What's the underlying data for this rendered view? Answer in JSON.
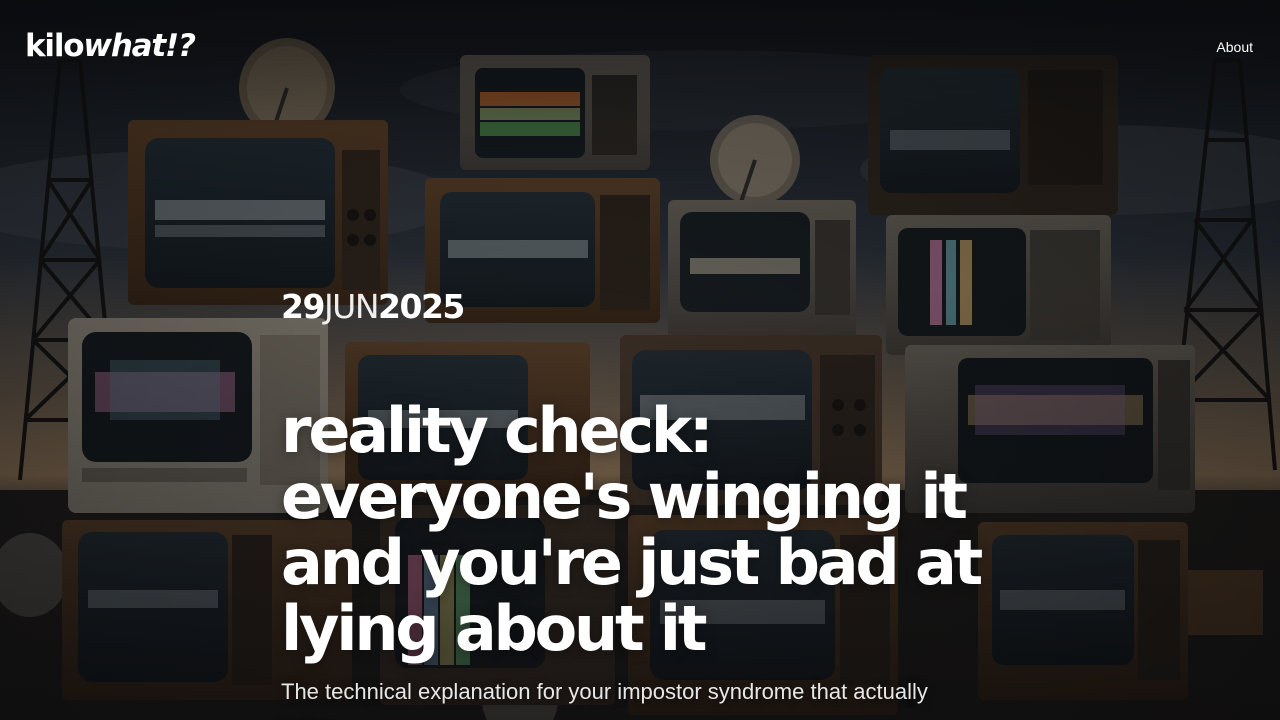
{
  "site": {
    "logo_plain": "kilo",
    "logo_italic": "what!?"
  },
  "nav": {
    "about_label": "About"
  },
  "post": {
    "date": {
      "day": "29",
      "month": "JUN",
      "year": "2025"
    },
    "title": "reality check: everyone's winging it and you're just bad at lying about it",
    "subtitle": "The technical explanation for your impostor syndrome that actually helps"
  },
  "hero_image": {
    "subject": "stacked vintage CRT televisions with radio towers at dusk",
    "colors": {
      "sky_top": "#1c2430",
      "sky_horizon": "#c9a47a",
      "tv_wood": "#6b4a2e",
      "tv_screen": "#2b3a44"
    }
  }
}
